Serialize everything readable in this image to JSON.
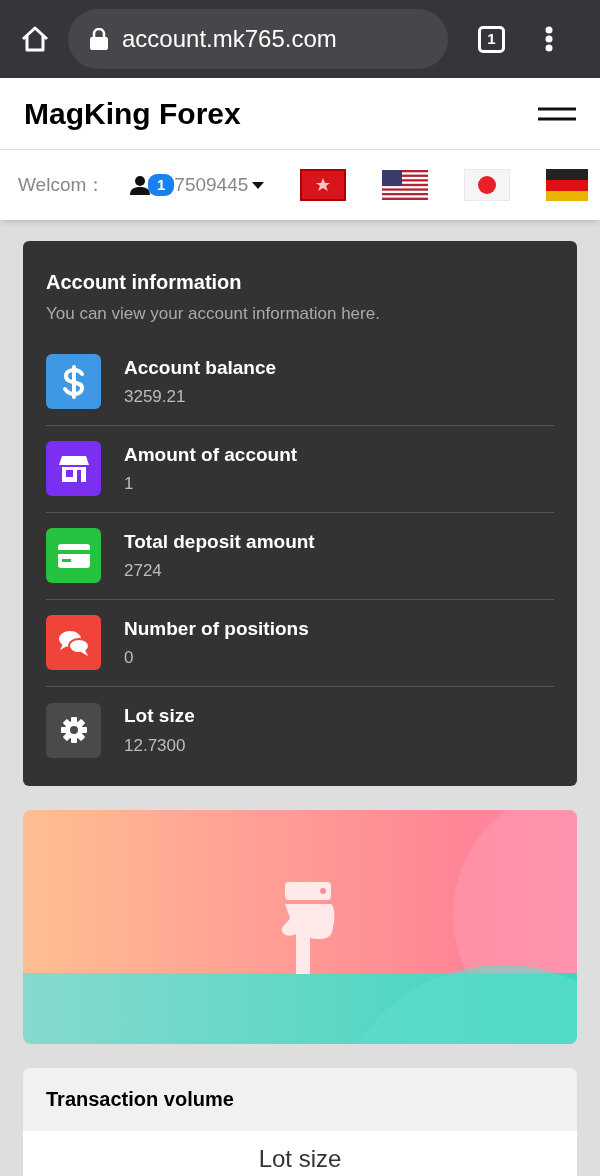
{
  "browser": {
    "url": "account.mk765.com",
    "tab_count": "1"
  },
  "header": {
    "title": "MagKing Forex"
  },
  "welcome": {
    "label": "Welcom：",
    "badge": "1",
    "user": "7509445"
  },
  "account": {
    "title": "Account information",
    "subtitle": "You can view your account information here.",
    "items": [
      {
        "label": "Account balance",
        "value": "3259.21",
        "color": "#3f98e4"
      },
      {
        "label": "Amount of account",
        "value": "1",
        "color": "#7b2ff0"
      },
      {
        "label": "Total deposit amount",
        "value": "2724",
        "color": "#25c23f"
      },
      {
        "label": "Number of positions",
        "value": "0",
        "color": "#f0443a"
      },
      {
        "label": "Lot size",
        "value": "12.7300",
        "color": "#4a4a4a"
      }
    ]
  },
  "transaction": {
    "title": "Transaction volume",
    "column": "Lot size"
  }
}
